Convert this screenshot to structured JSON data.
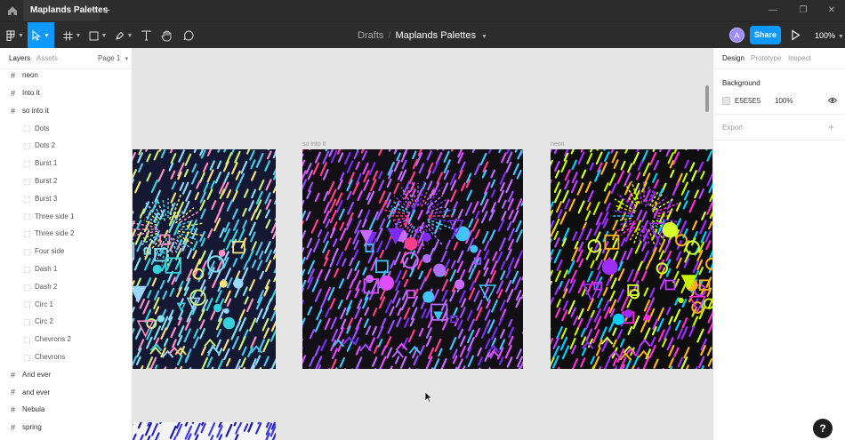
{
  "tab": {
    "title": "Maplands Palettes",
    "close": "×",
    "add": "+"
  },
  "window": {
    "minimize": "—",
    "maximize": "❐",
    "close": "✕"
  },
  "breadcrumb": {
    "folder": "Drafts",
    "separator": "/",
    "file": "Maplands Palettes"
  },
  "toolbar": {
    "avatar_initial": "A",
    "share_label": "Share",
    "zoom": "100%"
  },
  "left_panel": {
    "tabs": [
      "Layers",
      "Assets"
    ],
    "page": "Page 1",
    "layers": [
      {
        "label": "neon",
        "level": 0
      },
      {
        "label": "Into it",
        "level": 0
      },
      {
        "label": "so into it",
        "level": 0
      },
      {
        "label": "Dots",
        "level": 1
      },
      {
        "label": "Dots 2",
        "level": 1
      },
      {
        "label": "Burst 1",
        "level": 1
      },
      {
        "label": "Burst 2",
        "level": 1
      },
      {
        "label": "Burst 3",
        "level": 1
      },
      {
        "label": "Three side 1",
        "level": 1
      },
      {
        "label": "Three side 2",
        "level": 1
      },
      {
        "label": "Four side",
        "level": 1
      },
      {
        "label": "Dash 1",
        "level": 1
      },
      {
        "label": "Dash 2",
        "level": 1
      },
      {
        "label": "Circ 1",
        "level": 1
      },
      {
        "label": "Circ 2",
        "level": 1
      },
      {
        "label": "Chevrons 2",
        "level": 1
      },
      {
        "label": "Chevrons",
        "level": 1
      },
      {
        "label": "And ever",
        "level": 0
      },
      {
        "label": "and ever",
        "level": 0
      },
      {
        "label": "Nebula",
        "level": 0
      },
      {
        "label": "spring",
        "level": 0
      }
    ]
  },
  "canvas": {
    "frames": [
      {
        "name": "",
        "palette": [
          "#7ee0f0",
          "#4fc3e8",
          "#c8f07a",
          "#f6e27a",
          "#9ad7ff",
          "#ff8fc7",
          "#36d1dc"
        ],
        "bg": "#151833"
      },
      {
        "name": "so into it",
        "palette": [
          "#9b4dff",
          "#7a2cf0",
          "#c86bff",
          "#ff3d8b",
          "#e04cff",
          "#41c4ff",
          "#b06bff"
        ],
        "bg": "#131015"
      },
      {
        "name": "neon",
        "palette": [
          "#d7ff2e",
          "#c6f000",
          "#ffb21a",
          "#c33bff",
          "#ff2bd6",
          "#00d0ff",
          "#9f2bff"
        ],
        "bg": "#0e0e0e"
      },
      {
        "name": "",
        "palette": [
          "#2a2ad0",
          "#3a3ae6",
          "#1a1aa0"
        ],
        "bg": "#f4f4f4"
      }
    ]
  },
  "right_panel": {
    "tabs": [
      "Design",
      "Prototype",
      "Inspect"
    ],
    "background_title": "Background",
    "bg_hex": "E5E5E5",
    "bg_opacity": "100%",
    "export_title": "Export",
    "export_add": "+"
  },
  "help": "?",
  "colors": {
    "accent": "#0d99ff",
    "chrome": "#2c2c2c",
    "canvas": "#e5e5e5"
  }
}
